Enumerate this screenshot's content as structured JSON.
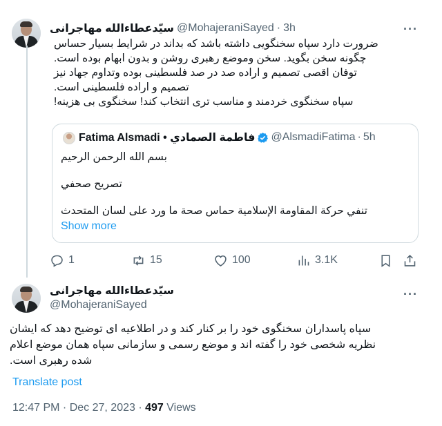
{
  "tweet1": {
    "author_name": "سیّدعطاءالله مهاجرانی",
    "handle": "@MohajeraniSayed",
    "separator": "·",
    "time": "3h",
    "body_lines": [
      "ضرورت دارد سپاه سخنگویی داشته باشد که بداند در شرایط بسیار حساس",
      "چگونه سخن بگوید.  سخن وموضع رهبری روشن و بدون ابهام بوده است.",
      "توفان اقصی تصمیم و اراده صد در صد فلسطینی بوده وتداوم جهاد نیز",
      "تصمیم و اراده فلسطینی است.",
      "سپاه سخنگوی خردمند و مناسب تری انتخاب کند! سخنگوی بی هزینه!"
    ],
    "quote": {
      "author_name": "Fatima Alsmadi • فاطمة الصمادي",
      "handle": "@AlsmadiFatima",
      "separator": "·",
      "time": "5h",
      "body_lines": [
        "بسم الله الرحمن الرحيم",
        "تصريح صحفي",
        "تنفي حركة المقاومة الإسلامية حماس صحة ما ورد على لسان المتحدث"
      ],
      "show_more": "Show more"
    },
    "actions": {
      "replies": "1",
      "reposts": "15",
      "likes": "100",
      "views": "3.1K"
    }
  },
  "tweet2": {
    "author_name": "سیّدعطاءالله مهاجرانی",
    "handle": "@MohajeraniSayed",
    "body_lines": [
      "سپاه پاسداران سخنگوی خود را بر کنار کند و در اطلاعیه ای توضیح دهد که ایشان",
      "نظریه شخصی خود را گفته اند و موضع  رسمی و سازمانی سپاه همان موضع  اعلام",
      "شده رهبری  است."
    ],
    "translate": "Translate post",
    "timestamp": "12:47 PM · Dec 27, 2023 ·",
    "views_count": "497",
    "views_label": "Views"
  },
  "colors": {
    "text": "#0f1419",
    "secondary": "#536471",
    "accent": "#1d9bf0",
    "border": "#cfd9de"
  },
  "icons": [
    "more-icon",
    "reply-icon",
    "repost-icon",
    "like-icon",
    "views-icon",
    "bookmark-icon",
    "share-icon",
    "verified-icon"
  ]
}
